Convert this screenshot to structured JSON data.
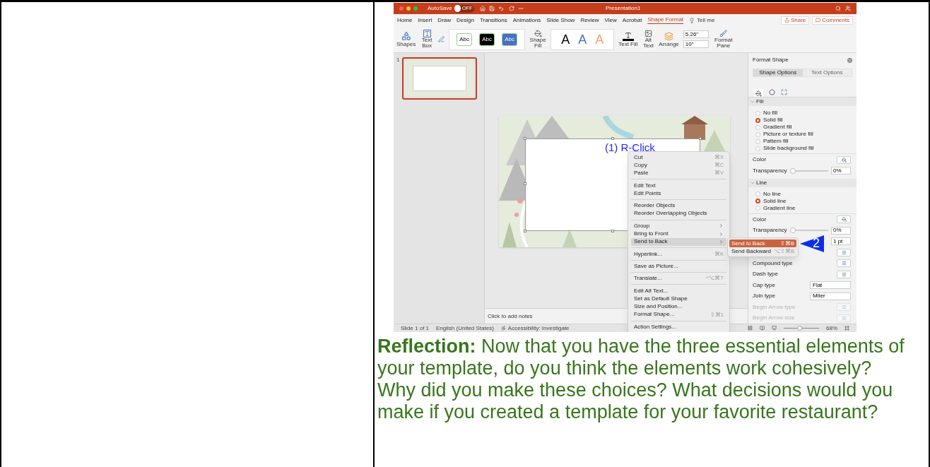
{
  "screenshot": {
    "title_bar": {
      "autosave": {
        "label": "AutoSave",
        "state": "OFF",
        "on": false
      },
      "title": "Presentation1"
    },
    "menu_tabs": [
      {
        "label": "Home",
        "selected": false
      },
      {
        "label": "Insert",
        "selected": false
      },
      {
        "label": "Draw",
        "selected": false
      },
      {
        "label": "Design",
        "selected": false
      },
      {
        "label": "Transitions",
        "selected": false
      },
      {
        "label": "Animations",
        "selected": false
      },
      {
        "label": "Slide Show",
        "selected": false
      },
      {
        "label": "Review",
        "selected": false
      },
      {
        "label": "View",
        "selected": false
      },
      {
        "label": "Acrobat",
        "selected": false
      },
      {
        "label": "Shape Format",
        "selected": true
      }
    ],
    "tell_me": "Tell me",
    "share_button": "Share",
    "comments_button": "Comments",
    "ribbon": {
      "shapes": "Shapes",
      "text_box": "Text Box",
      "shape_styles": [
        {
          "label": "Abc",
          "color": "#ffffff"
        },
        {
          "label": "Abc",
          "color": "#000000"
        },
        {
          "label": "Abc",
          "color": "#4472c4"
        }
      ],
      "shape_fill": "Shape Fill",
      "wordart_styles": [
        {
          "label": "A",
          "color": "#000000"
        },
        {
          "label": "A",
          "color": "#4472c4"
        },
        {
          "label": "A",
          "color": "#f4a261"
        }
      ],
      "text_fill": "Text Fill",
      "alt_text": "Alt Text",
      "arrange": "Arrange",
      "height": "5.26\"",
      "width": "10\"",
      "format_pane": "Format Pane"
    },
    "thumbnails": [
      {
        "number": "1",
        "selected": true
      }
    ],
    "slide": {
      "annotation": "(1) R-Click"
    },
    "notes_placeholder": "Click to add notes",
    "status_bar": {
      "slide": "Slide 1 of 1",
      "language": "English (United States)",
      "accessibility": "Accessibility: Investigate",
      "zoom": {
        "level": 0.45,
        "reading": "68%"
      }
    },
    "format_pane": {
      "title": "Format Shape",
      "tabs": [
        {
          "label": "Shape Options",
          "selected": true
        },
        {
          "label": "Text Options",
          "selected": false
        }
      ],
      "sections": [
        {
          "title": "Fill",
          "expanded": true,
          "rows": [
            {
              "kind": "radio",
              "label": "No fill",
              "selected": false,
              "disabled": false
            },
            {
              "kind": "radio",
              "label": "Solid fill",
              "selected": true,
              "disabled": false
            },
            {
              "kind": "radio",
              "label": "Gradient fill",
              "selected": false,
              "disabled": false
            },
            {
              "kind": "radio",
              "label": "Picture or texture fill",
              "selected": false,
              "disabled": false
            },
            {
              "kind": "radio",
              "label": "Pattern fill",
              "selected": false,
              "disabled": false
            },
            {
              "kind": "radio",
              "label": "Slide background fill",
              "selected": false,
              "disabled": false
            },
            {
              "kind": "color",
              "label": "Color",
              "disabled": false
            },
            {
              "kind": "slider",
              "label": "Transparency",
              "level": 0,
              "value": "0%",
              "disabled": false
            }
          ]
        },
        {
          "title": "Line",
          "expanded": true,
          "rows": [
            {
              "kind": "radio",
              "label": "No line",
              "selected": false,
              "disabled": false
            },
            {
              "kind": "radio",
              "label": "Solid line",
              "selected": true,
              "disabled": false
            },
            {
              "kind": "radio",
              "label": "Gradient line",
              "selected": false,
              "disabled": false
            },
            {
              "kind": "color",
              "label": "Color",
              "disabled": false
            },
            {
              "kind": "slider",
              "label": "Transparency",
              "level": 0,
              "value": "0%",
              "disabled": false
            },
            {
              "kind": "spinner",
              "value": "1 pt",
              "disabled": false
            },
            {
              "kind": "icon_dropdown",
              "disabled": false
            },
            {
              "kind": "icon_dropdown",
              "label": "Compound type",
              "disabled": false
            },
            {
              "kind": "icon_dropdown",
              "label": "Dash type",
              "disabled": false
            },
            {
              "kind": "select",
              "label": "Cap type",
              "value": "Flat",
              "disabled": false
            },
            {
              "kind": "select",
              "label": "Join type",
              "value": "Miter",
              "disabled": false
            },
            {
              "kind": "icon_dropdown",
              "label": "Begin Arrow type",
              "disabled": true
            },
            {
              "kind": "icon_dropdown",
              "label": "Begin Arrow size",
              "disabled": true
            }
          ]
        }
      ]
    },
    "context_menu": {
      "groups": [
        {
          "items": [
            {
              "label": "Cut",
              "shortcut": "⌘X",
              "submenu": false,
              "selected": false
            },
            {
              "label": "Copy",
              "shortcut": "⌘C",
              "submenu": false,
              "selected": false
            },
            {
              "label": "Paste",
              "shortcut": "⌘V",
              "submenu": false,
              "selected": false
            }
          ]
        },
        {
          "items": [
            {
              "label": "Edit Text",
              "submenu": false,
              "selected": false
            },
            {
              "label": "Edit Points",
              "submenu": false,
              "selected": false
            }
          ]
        },
        {
          "items": [
            {
              "label": "Reorder Objects",
              "submenu": false,
              "selected": false
            },
            {
              "label": "Reorder Overlapping Objects",
              "submenu": false,
              "selected": false
            }
          ]
        },
        {
          "items": [
            {
              "label": "Group",
              "submenu": true,
              "selected": false
            },
            {
              "label": "Bring to Front",
              "submenu": true,
              "selected": false
            },
            {
              "label": "Send to Back",
              "submenu": true,
              "selected": true
            }
          ]
        },
        {
          "items": [
            {
              "label": "Hyperlink...",
              "shortcut": "⌘K",
              "submenu": false,
              "selected": false
            }
          ]
        },
        {
          "items": [
            {
              "label": "Save as Picture...",
              "submenu": false,
              "selected": false
            }
          ]
        },
        {
          "items": [
            {
              "label": "Translate...",
              "shortcut": "^⌥⌘T",
              "submenu": false,
              "selected": false
            }
          ]
        },
        {
          "items": [
            {
              "label": "Edit Alt Text...",
              "submenu": false,
              "selected": false
            },
            {
              "label": "Set as Default Shape",
              "submenu": false,
              "selected": false
            },
            {
              "label": "Size and Position...",
              "submenu": false,
              "selected": false
            },
            {
              "label": "Format Shape...",
              "shortcut": "⇧⌘1",
              "submenu": false,
              "selected": false
            }
          ]
        },
        {
          "items": [
            {
              "label": "Action Settings...",
              "submenu": false,
              "selected": false
            }
          ]
        }
      ]
    },
    "submenu": {
      "items": [
        {
          "label": "Send to Back",
          "shortcut": "⇧⌘B",
          "selected": true
        },
        {
          "label": "Send Backward",
          "shortcut": "⌥⇧⌘B",
          "selected": false
        }
      ]
    },
    "step_marker": "2"
  },
  "reflection": "**Reflection:** Now that you have the three essential elements of your template, do you think the elements work cohesively? Why did you make these choices? What decisions would you make if you created a template for your favorite restaurant?"
}
